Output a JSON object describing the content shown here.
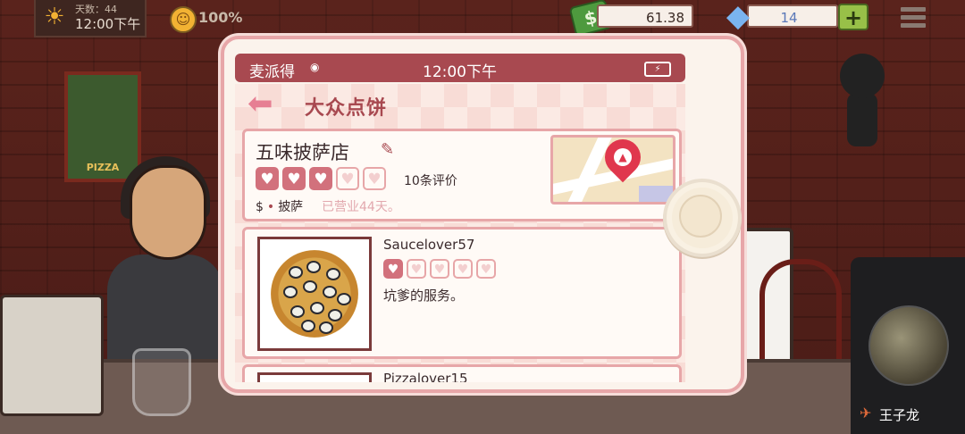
{
  "hud": {
    "days_label": "天数：44",
    "clock": "12:00下午",
    "satisfaction": "100%",
    "money": "61.38",
    "gems": "14",
    "gem_plus": "+"
  },
  "scene": {
    "poster_text": "PIZZA"
  },
  "phone": {
    "carrier": "麦派得",
    "time": "12:00下午",
    "app_title": "大众点饼",
    "shop": {
      "name": "五味披萨店",
      "rating": 3,
      "max_rating": 5,
      "review_count": "10条评价",
      "price": "$",
      "category": "披萨",
      "open_days": "已营业44天。"
    },
    "reviews": [
      {
        "reviewer": "Saucelover57",
        "rating": 1,
        "max_rating": 5,
        "text": "坑爹的服务。"
      },
      {
        "reviewer": "Pizzalover15"
      }
    ]
  },
  "overlay": {
    "username": "王子龙"
  },
  "icons": {
    "heart": "♥",
    "edit": "✎",
    "back": "◀",
    "sun": "☀",
    "gem": "♦",
    "money": "$"
  },
  "colors": {
    "accent": "#a84950",
    "heart_on": "#d2717c",
    "heart_border": "#e7a6a8",
    "pin": "#e0374d"
  }
}
